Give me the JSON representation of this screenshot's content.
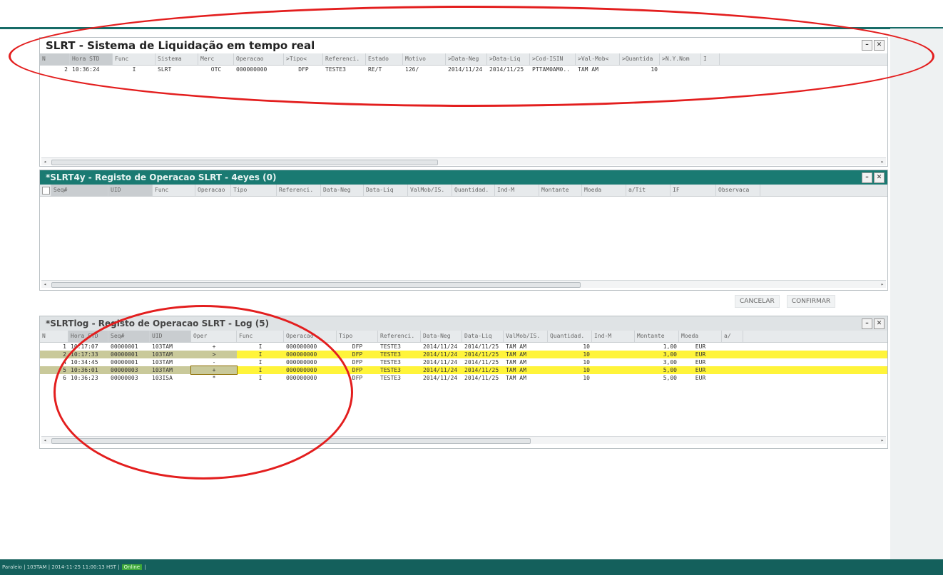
{
  "status_bar": {
    "text": "Paraleio | 103TAM | 2014-11-25 11:00:13 HST |",
    "online": "Online",
    "tail": "|"
  },
  "window_buttons": {
    "minimize": "–",
    "close": "✕"
  },
  "panel1": {
    "title": "SLRT - Sistema de Liquidação em tempo real",
    "headers": [
      "N",
      "Hora STD",
      "Func",
      "Sistema",
      "Merc",
      "Operacao",
      ">Tipo<",
      "Referenci.",
      "Estado",
      "Motivo",
      ">Data-Neg",
      ">Data-Liq",
      ">Cod-ISIN",
      ">Val-Mob<",
      ">Quantida",
      ">N.Y.Nom",
      "I"
    ],
    "rows": [
      [
        "2",
        "10:36:24",
        "I",
        "SLRT",
        "OTC",
        "000000000",
        "DFP",
        "TESTE3",
        "RE/T",
        "126/",
        "2014/11/24",
        "2014/11/25",
        "PTTAM0AM0..",
        "TAM AM",
        "10",
        "",
        ""
      ]
    ]
  },
  "panel2": {
    "title": "*SLRT4y - Registo de Operacao SLRT - 4eyes (0)",
    "headers": [
      "Seq#",
      "UID",
      "Func",
      "Operacao",
      "Tipo",
      "Referenci.",
      "Data-Neg",
      "Data-Liq",
      "ValMob/IS.",
      "Quantidad.",
      "Ind-M",
      "Montante",
      "Moeda",
      "a/Tit",
      "IF",
      "Observaca"
    ],
    "buttons": {
      "cancel": "CANCELAR",
      "confirm": "CONFIRMAR"
    }
  },
  "panel3": {
    "title": "*SLRTlog - Registo de Operacao SLRT - Log (5)",
    "headers": [
      "N",
      "Hora STD",
      "Seq#",
      "UID",
      "Oper",
      "Func",
      "Operacao",
      "Tipo",
      "Referenci.",
      "Data-Neg",
      "Data-Liq",
      "ValMob/IS.",
      "Quantidad.",
      "Ind-M",
      "Montante",
      "Moeda",
      "a/"
    ],
    "rows": [
      {
        "hl": false,
        "cells": [
          "1",
          "10:17:07",
          "00000001",
          "103TAM",
          "+",
          "I",
          "000000000",
          "DFP",
          "TESTE3",
          "2014/11/24",
          "2014/11/25",
          "TAM AM",
          "10",
          "",
          "1,00",
          "EUR",
          ""
        ]
      },
      {
        "hl": true,
        "cells": [
          "2",
          "10:17:33",
          "00000001",
          "103TAM",
          ">",
          "I",
          "000000000",
          "DFP",
          "TESTE3",
          "2014/11/24",
          "2014/11/25",
          "TAM AM",
          "10",
          "",
          "3,00",
          "EUR",
          ""
        ]
      },
      {
        "hl": false,
        "cells": [
          "4",
          "10:34:45",
          "00000001",
          "103TAM",
          "-",
          "I",
          "000000000",
          "DFP",
          "TESTE3",
          "2014/11/24",
          "2014/11/25",
          "TAM AM",
          "10",
          "",
          "3,00",
          "EUR",
          ""
        ]
      },
      {
        "hl": true,
        "cells": [
          "5",
          "10:36:01",
          "00000003",
          "103TAM",
          "+",
          "I",
          "000000000",
          "DFP",
          "TESTE3",
          "2014/11/24",
          "2014/11/25",
          "TAM AM",
          "10",
          "",
          "5,00",
          "EUR",
          ""
        ]
      },
      {
        "hl": false,
        "cells": [
          "6",
          "10:36:23",
          "00000003",
          "103ISA",
          "*",
          "I",
          "000000000",
          "DFP",
          "TESTE3",
          "2014/11/24",
          "2014/11/25",
          "TAM AM",
          "10",
          "",
          "5,00",
          "EUR",
          ""
        ]
      }
    ]
  }
}
